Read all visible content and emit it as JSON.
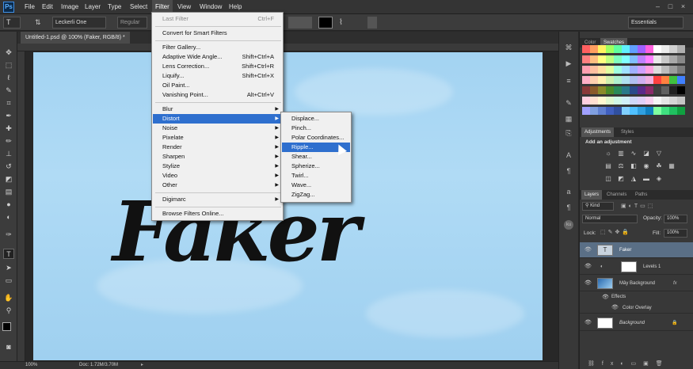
{
  "app": {
    "logo": "Ps"
  },
  "menubar": {
    "items": [
      "File",
      "Edit",
      "Image",
      "Layer",
      "Type",
      "Select",
      "Filter",
      "View",
      "Window",
      "Help"
    ],
    "window_controls": [
      "–",
      "□",
      "×"
    ]
  },
  "options": {
    "tool_icon": "T",
    "font_family": "Leckerli One",
    "font_style": "Regular",
    "workspace": "Essentials"
  },
  "document": {
    "tab_title": "Untitled-1.psd @ 100% (Faker, RGB/8) *",
    "art_text": "Faker"
  },
  "status": {
    "zoom": "100%",
    "doc_size": "Doc: 1.72M/3.70M"
  },
  "filter_menu": {
    "items": [
      {
        "label": "Last Filter",
        "shortcut": "Ctrl+F",
        "disabled": true
      },
      {
        "label": "Convert for Smart Filters",
        "shortcut": ""
      },
      {
        "label": "Filter Gallery...",
        "shortcut": ""
      },
      {
        "label": "Adaptive Wide Angle...",
        "shortcut": "Shift+Ctrl+A"
      },
      {
        "label": "Lens Correction...",
        "shortcut": "Shift+Ctrl+R"
      },
      {
        "label": "Liquify...",
        "shortcut": "Shift+Ctrl+X"
      },
      {
        "label": "Oil Paint...",
        "shortcut": ""
      },
      {
        "label": "Vanishing Point...",
        "shortcut": "Alt+Ctrl+V"
      },
      {
        "label": "Blur",
        "submenu": true
      },
      {
        "label": "Distort",
        "submenu": true,
        "highlighted": true
      },
      {
        "label": "Noise",
        "submenu": true
      },
      {
        "label": "Pixelate",
        "submenu": true
      },
      {
        "label": "Render",
        "submenu": true
      },
      {
        "label": "Sharpen",
        "submenu": true
      },
      {
        "label": "Stylize",
        "submenu": true
      },
      {
        "label": "Video",
        "submenu": true
      },
      {
        "label": "Other",
        "submenu": true
      },
      {
        "label": "Digimarc",
        "submenu": true
      },
      {
        "label": "Browse Filters Online..."
      }
    ]
  },
  "distort_menu": {
    "items": [
      "Displace...",
      "Pinch...",
      "Polar Coordinates...",
      "Ripple...",
      "Shear...",
      "Spherize...",
      "Twirl...",
      "Wave...",
      "ZigZag..."
    ],
    "highlighted": "Ripple..."
  },
  "panels": {
    "color_tabs": [
      "Color",
      "Swatches"
    ],
    "adjust_tabs": [
      "Adjustments",
      "Styles"
    ],
    "adjust_hint": "Add an adjustment",
    "layer_tabs": [
      "Layers",
      "Channels",
      "Paths"
    ],
    "kind": "Kind",
    "blend_mode": "Normal",
    "opacity_label": "Opacity:",
    "opacity_value": "100%",
    "lock_label": "Lock:",
    "fill_label": "Fill:",
    "fill_value": "100%",
    "layers": [
      {
        "name": "Faker",
        "type": "text",
        "selected": true
      },
      {
        "name": "Levels 1",
        "type": "adjustment"
      },
      {
        "name": "Mây Background",
        "type": "image",
        "fx": true
      },
      {
        "name": "Effects",
        "type": "effects"
      },
      {
        "name": "Color Overlay",
        "type": "effect"
      },
      {
        "name": "Background",
        "type": "background",
        "locked": true
      }
    ]
  },
  "colors": {
    "highlight": "#2e6fce",
    "canvas": "#a3d3f2",
    "selected_layer": "#5a6f86"
  }
}
